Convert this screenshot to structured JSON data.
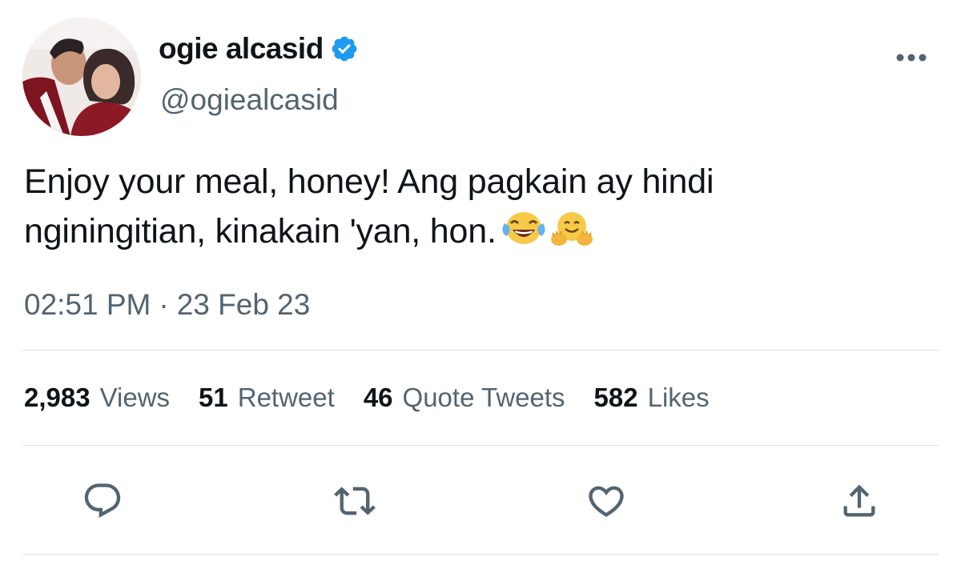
{
  "author": {
    "display_name": "ogie alcasid",
    "handle": "@ogiealcasid",
    "verified": true
  },
  "tweet": {
    "text_line_1": "Enjoy your meal, honey! Ang pagkain ay hindi",
    "text_line_2": "nginingitian, kinakain 'yan, hon.",
    "emojis": [
      "face-with-tears-of-joy",
      "hugging-face"
    ],
    "time": "02:51 PM",
    "separator": "·",
    "date": "23 Feb 23"
  },
  "stats": [
    {
      "count": "2,983",
      "label": "Views"
    },
    {
      "count": "51",
      "label": "Retweet"
    },
    {
      "count": "46",
      "label": "Quote Tweets"
    },
    {
      "count": "582",
      "label": "Likes"
    }
  ],
  "actions": [
    "reply-icon",
    "retweet-icon",
    "like-icon",
    "share-icon"
  ],
  "colors": {
    "text_primary": "#0f1419",
    "text_secondary": "#536471",
    "verified_blue": "#1d9bf0",
    "divider": "#dde1e4"
  }
}
